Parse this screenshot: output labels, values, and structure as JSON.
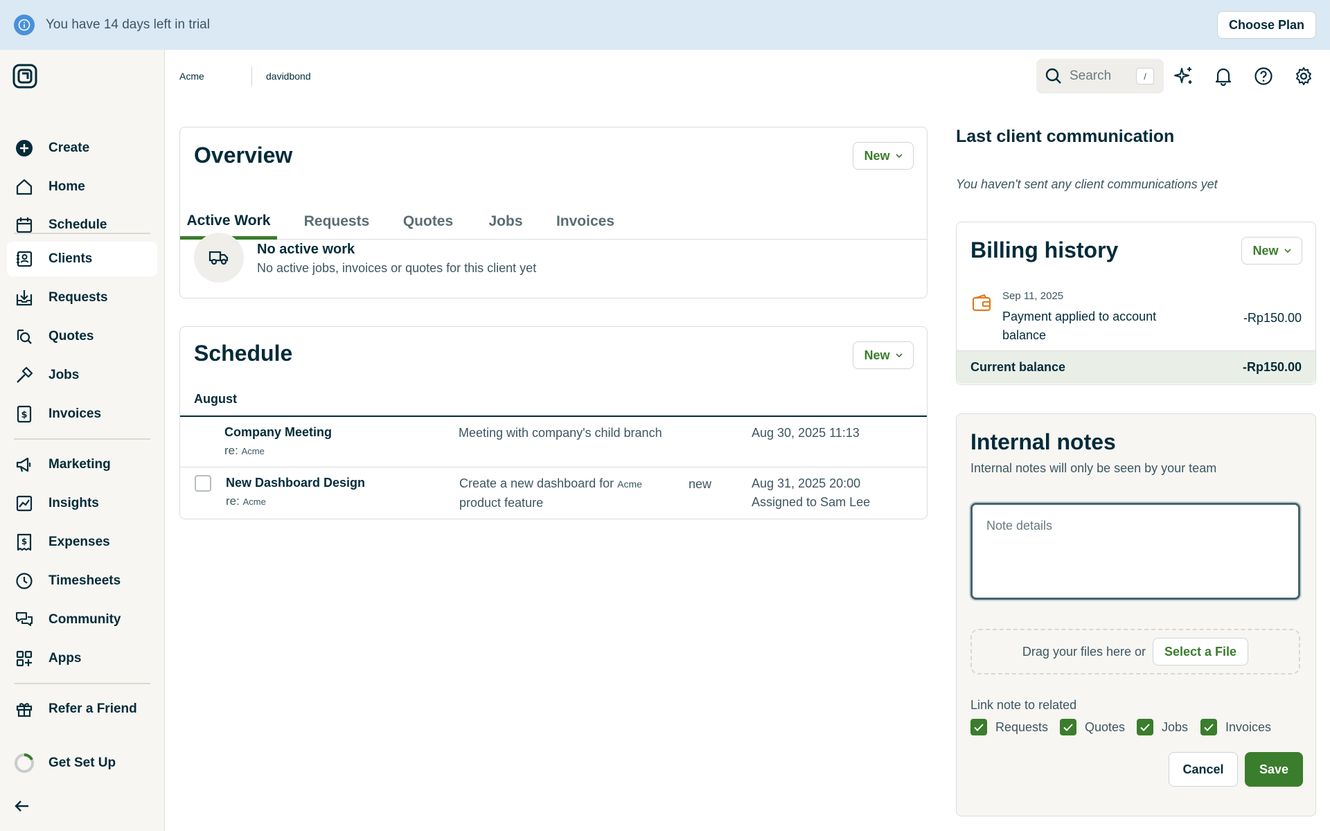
{
  "banner": {
    "message": "You have 14 days left in trial",
    "button": "Choose Plan"
  },
  "sidebar": {
    "items": [
      {
        "label": "Create",
        "icon": "plus-circle-icon"
      },
      {
        "label": "Home",
        "icon": "home-icon"
      },
      {
        "label": "Schedule",
        "icon": "calendar-icon"
      },
      {
        "label": "Clients",
        "icon": "clients-icon",
        "active": true
      },
      {
        "label": "Requests",
        "icon": "inbox-icon"
      },
      {
        "label": "Quotes",
        "icon": "quotes-icon"
      },
      {
        "label": "Jobs",
        "icon": "hammer-icon"
      },
      {
        "label": "Invoices",
        "icon": "invoice-icon"
      },
      {
        "label": "Marketing",
        "icon": "megaphone-icon"
      },
      {
        "label": "Insights",
        "icon": "insights-icon"
      },
      {
        "label": "Expenses",
        "icon": "expenses-icon"
      },
      {
        "label": "Timesheets",
        "icon": "clock-icon"
      },
      {
        "label": "Community",
        "icon": "community-icon"
      },
      {
        "label": "Apps",
        "icon": "apps-icon"
      },
      {
        "label": "Refer a Friend",
        "icon": "gift-icon"
      },
      {
        "label": "Get Set Up",
        "icon": "progress-ring-icon"
      }
    ]
  },
  "header": {
    "breadcrumbs": [
      "Acme",
      "davidbond"
    ],
    "search_placeholder": "Search",
    "search_shortcut": "/"
  },
  "overview": {
    "title": "Overview",
    "new_label": "New",
    "tabs": [
      "Active Work",
      "Requests",
      "Quotes",
      "Jobs",
      "Invoices"
    ],
    "active_tab": "Active Work",
    "empty_title": "No active work",
    "empty_subtitle": "No active jobs, invoices or quotes for this client yet"
  },
  "schedule": {
    "title": "Schedule",
    "new_label": "New",
    "month": "August",
    "events": [
      {
        "title": "Company Meeting",
        "re_prefix": "re:",
        "re_client": "Acme",
        "description": "Meeting with company's child branch",
        "date": "Aug 30, 2025 11:13"
      },
      {
        "title": "New Dashboard Design",
        "re_prefix": "re:",
        "re_client": "Acme",
        "description_pre": "Create a new dashboard for",
        "description_client": "Acme",
        "description_post": "product feature",
        "status": "new",
        "date": "Aug 31, 2025 20:00",
        "assigned": "Assigned to Sam Lee"
      }
    ]
  },
  "communication": {
    "title": "Last client communication",
    "empty": "You haven't sent any client communications yet"
  },
  "billing": {
    "title": "Billing history",
    "new_label": "New",
    "entries": [
      {
        "date": "Sep 11, 2025",
        "description": "Payment applied to account balance",
        "amount": "-Rp150.00"
      }
    ],
    "balance_label": "Current balance",
    "balance_value": "-Rp150.00"
  },
  "notes": {
    "title": "Internal notes",
    "subtitle": "Internal notes will only be seen by your team",
    "placeholder": "Note details",
    "drop_text": "Drag your files here or",
    "select_file": "Select a File",
    "link_label": "Link note to related",
    "links": [
      "Requests",
      "Quotes",
      "Jobs",
      "Invoices"
    ],
    "cancel": "Cancel",
    "save": "Save"
  },
  "colors": {
    "accent": "#3a7d2c",
    "text": "#032b3a",
    "banner": "#dbe9f5",
    "sidebar": "#f7f6f2"
  }
}
